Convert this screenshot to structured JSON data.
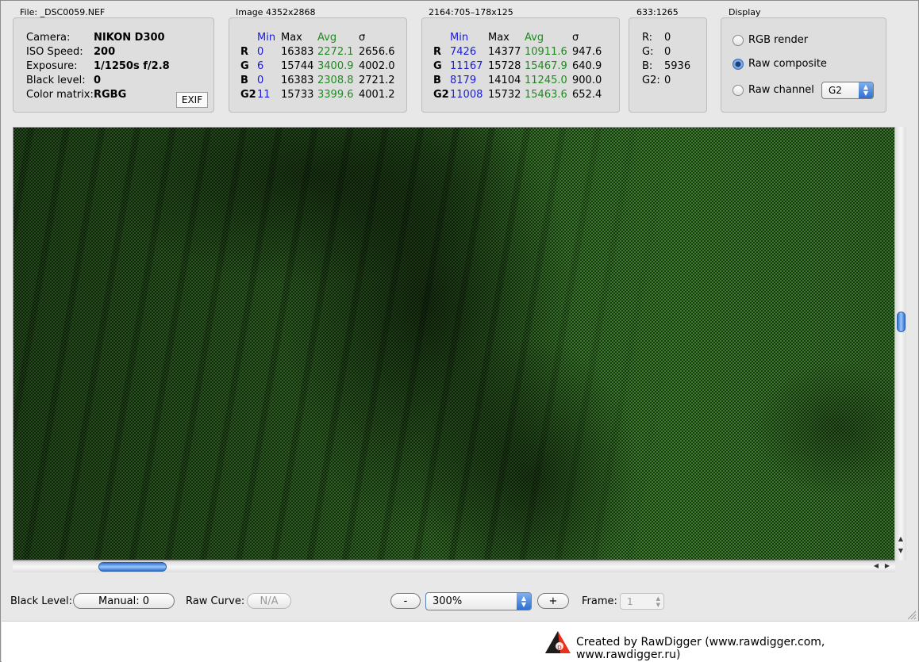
{
  "file": {
    "caption": "File: _DSC0059.NEF",
    "rows": [
      {
        "label": "Camera:",
        "value": "NIKON D300"
      },
      {
        "label": "ISO Speed:",
        "value": "200"
      },
      {
        "label": "Exposure:",
        "value": "1/1250s f/2.8"
      },
      {
        "label": "Black level:",
        "value": "0"
      },
      {
        "label": "Color matrix:",
        "value": "RGBG"
      }
    ],
    "exif_button": "EXIF"
  },
  "image_stats": {
    "caption": "Image 4352x2868",
    "headers": [
      "Min",
      "Max",
      "Avg",
      "σ"
    ],
    "rows": [
      {
        "ch": "R",
        "min": "0",
        "max": "16383",
        "avg": "2272.1",
        "sd": "2656.6"
      },
      {
        "ch": "G",
        "min": "6",
        "max": "15744",
        "avg": "3400.9",
        "sd": "4002.0"
      },
      {
        "ch": "B",
        "min": "0",
        "max": "16383",
        "avg": "2308.8",
        "sd": "2721.2"
      },
      {
        "ch": "G2",
        "min": "11",
        "max": "15733",
        "avg": "3399.6",
        "sd": "4001.2"
      }
    ]
  },
  "selection_stats": {
    "caption": "2164:705–178x125",
    "headers": [
      "Min",
      "Max",
      "Avg",
      "σ"
    ],
    "rows": [
      {
        "ch": "R",
        "min": "7426",
        "max": "14377",
        "avg": "10911.6",
        "sd": "947.6"
      },
      {
        "ch": "G",
        "min": "11167",
        "max": "15728",
        "avg": "15467.9",
        "sd": "640.9"
      },
      {
        "ch": "B",
        "min": "8179",
        "max": "14104",
        "avg": "11245.0",
        "sd": "900.0"
      },
      {
        "ch": "G2",
        "min": "11008",
        "max": "15732",
        "avg": "15463.6",
        "sd": "652.4"
      }
    ]
  },
  "pixel": {
    "caption": "633:1265",
    "rows": [
      {
        "label": "R:",
        "value": "0"
      },
      {
        "label": "G:",
        "value": "0"
      },
      {
        "label": "B:",
        "value": "5936"
      },
      {
        "label": "G2:",
        "value": "0"
      }
    ]
  },
  "display": {
    "caption": "Display",
    "options": [
      "RGB render",
      "Raw composite",
      "Raw channel"
    ],
    "selected": "Raw composite",
    "channel_value": "G2"
  },
  "bottom": {
    "black_level_label": "Black Level:",
    "black_level_value": "Manual: 0",
    "raw_curve_label": "Raw Curve:",
    "raw_curve_value": "N/A",
    "zoom_minus": "-",
    "zoom_value": "300%",
    "zoom_plus": "+",
    "frame_label": "Frame:",
    "frame_value": "1"
  },
  "footer": {
    "credit": "Created by RawDigger (www.rawdigger.com, www.rawdigger.ru)"
  },
  "colors": {
    "min_color": "#1a1adb",
    "avg_color": "#1f8a1f",
    "accent": "#2e6fd3"
  }
}
